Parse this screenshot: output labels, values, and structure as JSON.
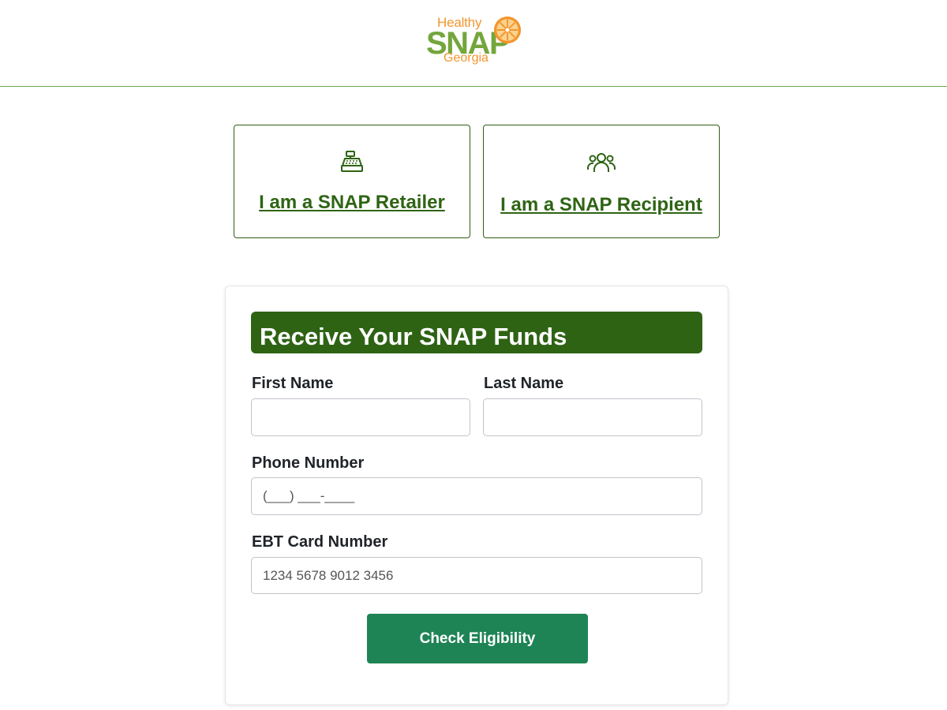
{
  "header": {
    "logo": {
      "line1": "Healthy",
      "line2": "SNAP",
      "line3": "Georgia"
    }
  },
  "roles": {
    "retailer": {
      "label": "I am a SNAP Retailer",
      "icon": "cash-register-icon"
    },
    "recipient": {
      "label": "I am a SNAP Recipient",
      "icon": "users-group-icon"
    }
  },
  "form": {
    "title": "Receive Your SNAP Funds",
    "first_name": {
      "label": "First Name",
      "value": "",
      "placeholder": ""
    },
    "last_name": {
      "label": "Last Name",
      "value": "",
      "placeholder": ""
    },
    "phone": {
      "label": "Phone Number",
      "value": "",
      "placeholder": "(___) ___-____"
    },
    "ebt": {
      "label": "EBT Card Number",
      "value": "",
      "placeholder": "1234 5678 9012 3456"
    },
    "submit_label": "Check Eligibility"
  },
  "colors": {
    "brand_green": "#2e6314",
    "button_green": "#1e8455",
    "logo_green": "#74a63c",
    "logo_orange": "#f2962e"
  }
}
